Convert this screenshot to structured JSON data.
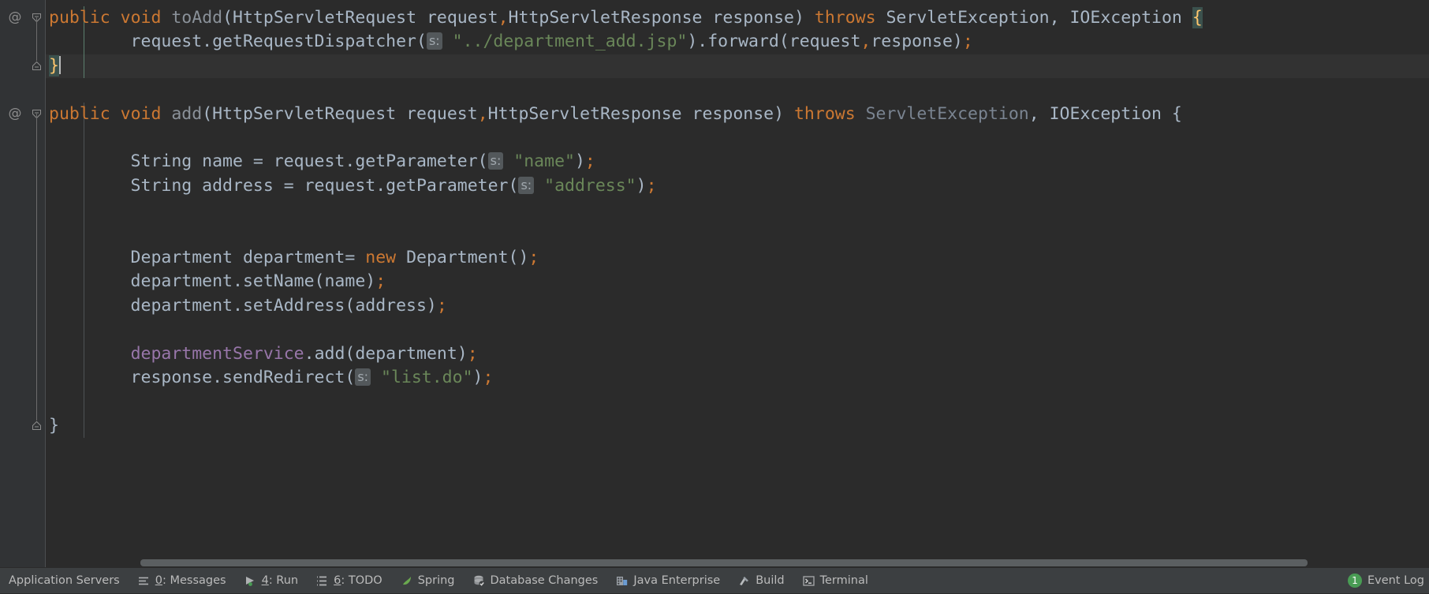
{
  "editor": {
    "language": "Java",
    "theme": "Darcula",
    "gutter_annotation": "@",
    "caret_line_index": 2,
    "lines": [
      {
        "index": 0,
        "indent": 0,
        "annotation": "@",
        "fold": "collapse",
        "tokens": [
          {
            "t": "public",
            "c": "kw"
          },
          {
            "t": " ",
            "c": "ident"
          },
          {
            "t": "void",
            "c": "kw"
          },
          {
            "t": " ",
            "c": "ident"
          },
          {
            "t": "toAdd",
            "c": "mdecl"
          },
          {
            "t": "(HttpServletRequest request",
            "c": "ident"
          },
          {
            "t": ",",
            "c": "comma"
          },
          {
            "t": "HttpServletResponse response) ",
            "c": "ident"
          },
          {
            "t": "throws",
            "c": "kw"
          },
          {
            "t": " ServletException, IOException ",
            "c": "ident"
          },
          {
            "t": "{",
            "c": "brace-hl"
          }
        ]
      },
      {
        "index": 1,
        "indent": 2,
        "tokens": [
          {
            "t": "        request.getRequestDispatcher(",
            "c": "ident"
          },
          {
            "t": "s:",
            "c": "hint"
          },
          {
            "t": " ",
            "c": "ident"
          },
          {
            "t": "\"../department_add.jsp\"",
            "c": "str"
          },
          {
            "t": ").forward(request",
            "c": "ident"
          },
          {
            "t": ",",
            "c": "comma"
          },
          {
            "t": "response)",
            "c": "ident"
          },
          {
            "t": ";",
            "c": "semi"
          }
        ]
      },
      {
        "index": 2,
        "indent": 0,
        "fold": "end",
        "tokens": [
          {
            "t": "}",
            "c": "brace-hl"
          },
          {
            "t": "caret",
            "c": "caret"
          }
        ]
      },
      {
        "index": 3,
        "indent": 0,
        "tokens": []
      },
      {
        "index": 4,
        "indent": 0,
        "annotation": "@",
        "fold": "collapse",
        "tokens": [
          {
            "t": "public",
            "c": "kw"
          },
          {
            "t": " ",
            "c": "ident"
          },
          {
            "t": "void",
            "c": "kw"
          },
          {
            "t": " ",
            "c": "ident"
          },
          {
            "t": "add",
            "c": "mdecl"
          },
          {
            "t": "(HttpServletRequest request",
            "c": "ident"
          },
          {
            "t": ",",
            "c": "comma"
          },
          {
            "t": "HttpServletResponse response) ",
            "c": "ident"
          },
          {
            "t": "throws",
            "c": "kw"
          },
          {
            "t": " ",
            "c": "ident"
          },
          {
            "t": "ServletException",
            "c": "dim"
          },
          {
            "t": ", IOException {",
            "c": "ident"
          }
        ]
      },
      {
        "index": 5,
        "indent": 2,
        "tokens": []
      },
      {
        "index": 6,
        "indent": 2,
        "tokens": [
          {
            "t": "        String name = request.getParameter(",
            "c": "ident"
          },
          {
            "t": "s:",
            "c": "hint"
          },
          {
            "t": " ",
            "c": "ident"
          },
          {
            "t": "\"name\"",
            "c": "str"
          },
          {
            "t": ")",
            "c": "ident"
          },
          {
            "t": ";",
            "c": "semi"
          }
        ]
      },
      {
        "index": 7,
        "indent": 2,
        "tokens": [
          {
            "t": "        String address = request.getParameter(",
            "c": "ident"
          },
          {
            "t": "s:",
            "c": "hint"
          },
          {
            "t": " ",
            "c": "ident"
          },
          {
            "t": "\"address\"",
            "c": "str"
          },
          {
            "t": ")",
            "c": "ident"
          },
          {
            "t": ";",
            "c": "semi"
          }
        ]
      },
      {
        "index": 8,
        "indent": 2,
        "tokens": []
      },
      {
        "index": 9,
        "indent": 2,
        "tokens": []
      },
      {
        "index": 10,
        "indent": 2,
        "tokens": [
          {
            "t": "        Department department= ",
            "c": "ident"
          },
          {
            "t": "new",
            "c": "kw"
          },
          {
            "t": " Department()",
            "c": "ident"
          },
          {
            "t": ";",
            "c": "semi"
          }
        ]
      },
      {
        "index": 11,
        "indent": 2,
        "tokens": [
          {
            "t": "        department.setName(name)",
            "c": "ident"
          },
          {
            "t": ";",
            "c": "semi"
          }
        ]
      },
      {
        "index": 12,
        "indent": 2,
        "tokens": [
          {
            "t": "        department.setAddress(address)",
            "c": "ident"
          },
          {
            "t": ";",
            "c": "semi"
          }
        ]
      },
      {
        "index": 13,
        "indent": 2,
        "tokens": []
      },
      {
        "index": 14,
        "indent": 2,
        "tokens": [
          {
            "t": "        ",
            "c": "ident"
          },
          {
            "t": "departmentService",
            "c": "field"
          },
          {
            "t": ".add(department)",
            "c": "ident"
          },
          {
            "t": ";",
            "c": "semi"
          }
        ]
      },
      {
        "index": 15,
        "indent": 2,
        "tokens": [
          {
            "t": "        response.sendRedirect(",
            "c": "ident"
          },
          {
            "t": "s:",
            "c": "hint"
          },
          {
            "t": " ",
            "c": "ident"
          },
          {
            "t": "\"list.do\"",
            "c": "str"
          },
          {
            "t": ")",
            "c": "ident"
          },
          {
            "t": ";",
            "c": "semi"
          }
        ]
      },
      {
        "index": 16,
        "indent": 0,
        "tokens": []
      },
      {
        "index": 17,
        "indent": 0,
        "fold": "end",
        "tokens": [
          {
            "t": "}",
            "c": "ident"
          }
        ]
      }
    ]
  },
  "toolwindow_bar": {
    "items": [
      {
        "id": "application-servers",
        "mnemonic": "",
        "label": "Application Servers",
        "icon": "none"
      },
      {
        "id": "messages",
        "mnemonic": "0",
        "label": ": Messages",
        "icon": "messages-icon"
      },
      {
        "id": "run",
        "mnemonic": "4",
        "label": ": Run",
        "icon": "run-icon"
      },
      {
        "id": "todo",
        "mnemonic": "6",
        "label": ": TODO",
        "icon": "todo-icon"
      },
      {
        "id": "spring",
        "mnemonic": "",
        "label": "Spring",
        "icon": "spring-icon"
      },
      {
        "id": "database-changes",
        "mnemonic": "",
        "label": "Database Changes",
        "icon": "database-icon"
      },
      {
        "id": "java-enterprise",
        "mnemonic": "",
        "label": "Java Enterprise",
        "icon": "java-enterprise-icon"
      },
      {
        "id": "build",
        "mnemonic": "",
        "label": "Build",
        "icon": "build-icon"
      },
      {
        "id": "terminal",
        "mnemonic": "",
        "label": "Terminal",
        "icon": "terminal-icon"
      }
    ],
    "event_log": {
      "count": "1",
      "label": "Event Log"
    }
  },
  "colors": {
    "editor_bg": "#2b2b2b",
    "gutter_bg": "#313335",
    "statusbar_bg": "#3c3f41",
    "keyword": "#cc7832",
    "string": "#6a8759",
    "identifier": "#a9b7c6",
    "field": "#9876aa",
    "brace_match_bg": "#3b514d",
    "brace_match_fg": "#ffc66d",
    "badge_green": "#499c54"
  }
}
